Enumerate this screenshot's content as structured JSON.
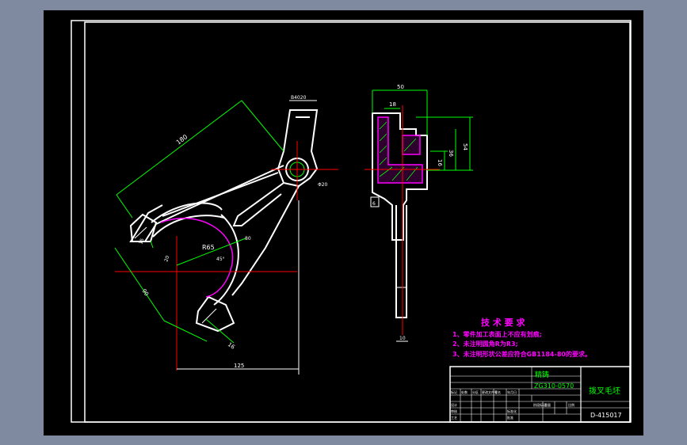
{
  "colors": {
    "background_outer": "#7f8aa0",
    "canvas": "#000000",
    "line": "#ffffff",
    "dimension": "#00ff00",
    "centerline": "#ff0000",
    "hatch": "#ff00ff",
    "notes": "#ff00ff"
  },
  "dimensions": {
    "main_length": "180",
    "top_width": "B4020",
    "hole_dia": "Φ20",
    "arc_radius": "R65",
    "chord": "90",
    "small_gap": "16",
    "small_left": "15",
    "tilt": "45°",
    "angle_small": "80",
    "bottom_pad": "20",
    "horizontal": "125",
    "side_top": "50",
    "side_inner": "18",
    "side_height": "54",
    "side_mid": "36",
    "side_small": "16",
    "side_left": "6",
    "side_bottom": "10"
  },
  "tech_notes": {
    "title": "技 术 要 求",
    "items": [
      "1、零件加工表面上不应有划痕;",
      "2、未注明圆角R为R3;",
      "3、未注明形状公差应符合GB1184-80的要求。"
    ]
  },
  "title_block": {
    "material": "精铸",
    "material_code": "ZG310-0570",
    "part_name": "拨叉毛坯",
    "drawing_number": "D-415017",
    "small_labels": [
      "标记",
      "处数",
      "分区",
      "更改文件号",
      "签名",
      "年月日"
    ],
    "stage_labels": [
      "阶段标记",
      "重量",
      "比例"
    ],
    "row_labels": [
      "设计",
      "审核",
      "工艺",
      "标准化",
      "批准"
    ]
  }
}
